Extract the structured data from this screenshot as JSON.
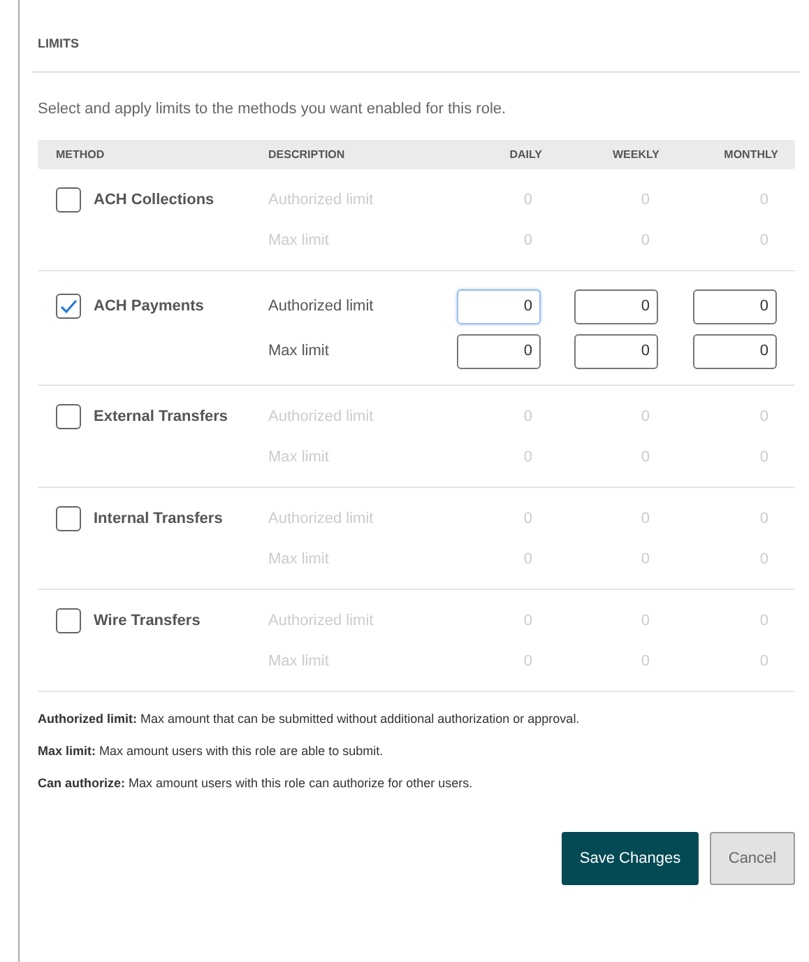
{
  "section_title": "LIMITS",
  "intro": "Select and apply limits to the methods you want enabled for this role.",
  "table": {
    "columns": [
      "METHOD",
      "DESCRIPTION",
      "DAILY",
      "WEEKLY",
      "MONTHLY"
    ],
    "methods": [
      {
        "name": "ACH Collections",
        "checked": false,
        "limits": [
          {
            "label": "Authorized limit",
            "cells": [
              {
                "value": "0"
              },
              {
                "value": "0"
              },
              {
                "value": "0"
              }
            ]
          },
          {
            "label": "Max limit",
            "cells": [
              {
                "value": "0"
              },
              {
                "value": "0"
              },
              {
                "value": "0"
              }
            ]
          }
        ]
      },
      {
        "name": "ACH Payments",
        "checked": true,
        "limits": [
          {
            "label": "Authorized limit",
            "cells": [
              {
                "value": "0",
                "focused": true
              },
              {
                "value": "0",
                "focused": false
              },
              {
                "value": "0",
                "focused": false
              }
            ]
          },
          {
            "label": "Max limit",
            "cells": [
              {
                "value": "0",
                "focused": false
              },
              {
                "value": "0",
                "focused": false
              },
              {
                "value": "0",
                "focused": false
              }
            ]
          }
        ]
      },
      {
        "name": "External Transfers",
        "checked": false,
        "limits": [
          {
            "label": "Authorized limit",
            "cells": [
              {
                "value": "0"
              },
              {
                "value": "0"
              },
              {
                "value": "0"
              }
            ]
          },
          {
            "label": "Max limit",
            "cells": [
              {
                "value": "0"
              },
              {
                "value": "0"
              },
              {
                "value": "0"
              }
            ]
          }
        ]
      },
      {
        "name": "Internal Transfers",
        "checked": false,
        "limits": [
          {
            "label": "Authorized limit",
            "cells": [
              {
                "value": "0"
              },
              {
                "value": "0"
              },
              {
                "value": "0"
              }
            ]
          },
          {
            "label": "Max limit",
            "cells": [
              {
                "value": "0"
              },
              {
                "value": "0"
              },
              {
                "value": "0"
              }
            ]
          }
        ]
      },
      {
        "name": "Wire Transfers",
        "checked": false,
        "limits": [
          {
            "label": "Authorized limit",
            "cells": [
              {
                "value": "0"
              },
              {
                "value": "0"
              },
              {
                "value": "0"
              }
            ]
          },
          {
            "label": "Max limit",
            "cells": [
              {
                "value": "0"
              },
              {
                "value": "0"
              },
              {
                "value": "0"
              }
            ]
          }
        ]
      }
    ]
  },
  "notes": [
    "**Authorized limit:** Max amount that can be submitted without additional authorization or approval.",
    "**Max limit:** Max amount users with this role are able to submit.",
    "**Can authorize:** Max amount users with this role can authorize for other users."
  ],
  "buttons": [
    {
      "label": "Save Changes",
      "kind": "primary"
    },
    {
      "label": "Cancel",
      "kind": "secondary"
    }
  ]
}
